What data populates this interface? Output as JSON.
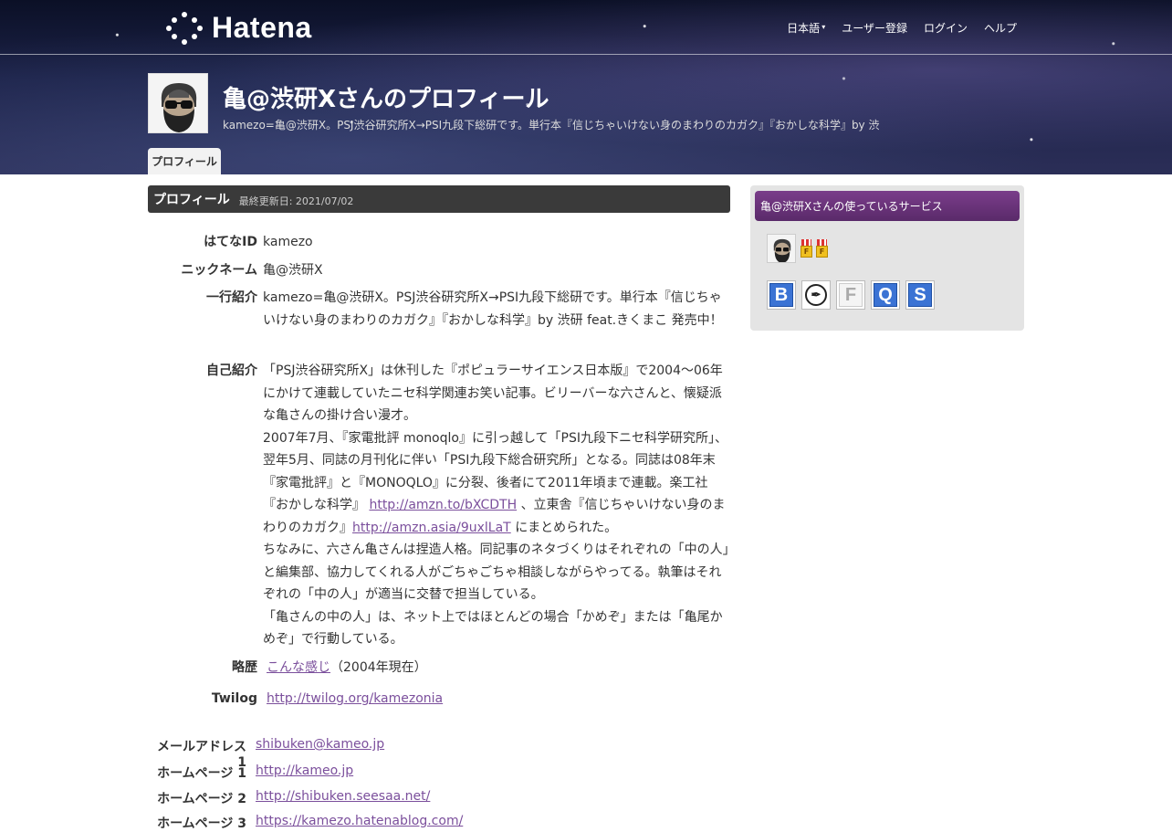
{
  "topbar": {
    "logo_text": "Hatena",
    "nav": {
      "language": "日本語",
      "register": "ユーザー登録",
      "login": "ログイン",
      "help": "ヘルプ"
    }
  },
  "profile": {
    "title": "亀@渋研Xさんのプロフィール",
    "description": "kamezo=亀@渋研X。PSJ渋谷研究所X→PSI九段下総研です。単行本『信じちゃいけない身のまわりのカガク』『おかしな科学』by 渋",
    "tab": "プロフィール"
  },
  "section": {
    "title": "プロフィール",
    "updated": "最終更新日: 2021/07/02"
  },
  "fields": {
    "hatena_id_label": "はてなID",
    "hatena_id": "kamezo",
    "nickname_label": "ニックネーム",
    "nickname": "亀@渋研X",
    "oneliner_label": "一行紹介",
    "oneliner": "kamezo=亀@渋研X。PSJ渋谷研究所X→PSI九段下総研です。単行本『信じちゃいけない身のまわりのカガク』『おかしな科学』by 渋研 feat.きくまこ 発売中！",
    "intro_label": "自己紹介",
    "intro_p1": "「PSJ渋谷研究所X」は休刊した『ポピュラーサイエンス日本版』で2004〜06年にかけて連載していたニセ科学関連お笑い記事。ビリーバーな六さんと、懐疑派な亀さんの掛け合い漫才。",
    "intro_p2a": "2007年7月、『家電批評 monoqlo』に引っ越して「PSI九段下ニセ科学研究所」、翌年5月、同誌の月刊化に伴い「PSI九段下総合研究所」となる。同誌は08年末『家電批評』と『MONOQLO』に分裂、後者にて2011年頃まで連載。楽工社『おかしな科学』",
    "intro_link1": "http://amzn.to/bXCDTH",
    "intro_p2b": "、立東舎『信じちゃいけない身のまわりのカガク』",
    "intro_link2": "http://amzn.asia/9uxlLaT",
    "intro_p2c": "にまとめられた。",
    "intro_p3": "ちなみに、六さん亀さんは捏造人格。同記事のネタづくりはそれぞれの「中の人」と編集部、協力してくれる人がごちゃごちゃ相談しながらやってる。執筆はそれぞれの「中の人」が適当に交替で担当している。",
    "intro_p4": "「亀さんの中の人」は、ネット上ではほとんどの場合「かめぞ」または「亀尾かめぞ」で行動している。",
    "history_label": "略歴",
    "history_link": "こんな感じ",
    "history_note": "（2004年現在）",
    "twilog_label": "Twilog",
    "twilog_link": "http://twilog.org/kamezonia",
    "email_label": "メールアドレス 1",
    "email": "shibuken@kameo.jp",
    "hp1_label": "ホームページ 1",
    "hp1": "http://kameo.jp",
    "hp2_label": "ホームページ 2",
    "hp2": "http://shibuken.seesaa.net/",
    "hp3_label": "ホームページ 3",
    "hp3": "https://kamezo.hatenablog.com/"
  },
  "sidebar": {
    "title": "亀@渋研Xさんの使っているサービス",
    "services": [
      {
        "icon": "hatena-bookmark-icon",
        "glyph": "B"
      },
      {
        "icon": "hatena-pen-icon",
        "glyph": "✒"
      },
      {
        "icon": "hatena-fotolife-icon",
        "glyph": "F"
      },
      {
        "icon": "hatena-question-icon",
        "glyph": "Q"
      },
      {
        "icon": "hatena-star-icon",
        "glyph": "S"
      }
    ],
    "medal_glyph": "F"
  }
}
